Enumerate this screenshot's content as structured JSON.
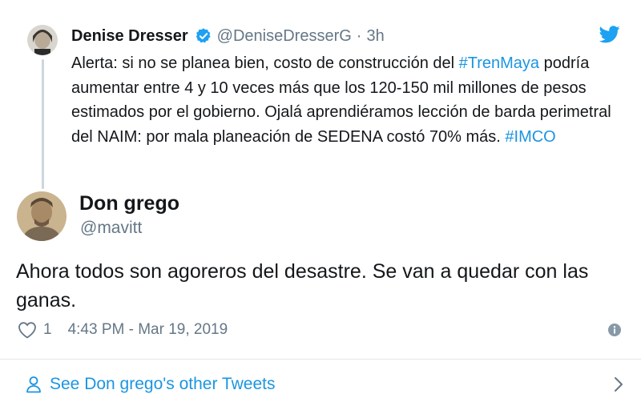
{
  "parent_tweet": {
    "author_name": "Denise Dresser",
    "handle": "@DeniseDresserG",
    "separator": "·",
    "time": "3h",
    "text_parts": {
      "a": "Alerta: si no se planea bien, costo de construcción del ",
      "hashtag1": "#TrenMaya",
      "b": " podría aumentar entre 4 y 10 veces más que los 120-150 mil millones de pesos estimados por el gobierno. Ojalá aprendiéramos lección de barda perimetral del NAIM: por mala planeación de SEDENA costó 70% más. ",
      "hashtag2": "#IMCO"
    }
  },
  "main_tweet": {
    "author_name": "Don grego",
    "handle": "@mavitt",
    "text": "Ahora todos son agoreros del desastre. Se van a quedar con las ganas.",
    "like_count": "1",
    "timestamp": "4:43 PM - Mar 19, 2019"
  },
  "footer": {
    "link_text": "See Don grego's other Tweets"
  },
  "icons": {
    "verified": "verified-badge-icon",
    "twitter": "twitter-bird-icon",
    "heart": "heart-icon",
    "info": "info-icon",
    "person": "person-icon",
    "chevron": "chevron-right-icon"
  },
  "colors": {
    "link": "#1b95e0",
    "muted": "#657786",
    "text": "#14171a",
    "twitter_blue": "#1da1f2",
    "thread_line": "#ccd6dd"
  }
}
